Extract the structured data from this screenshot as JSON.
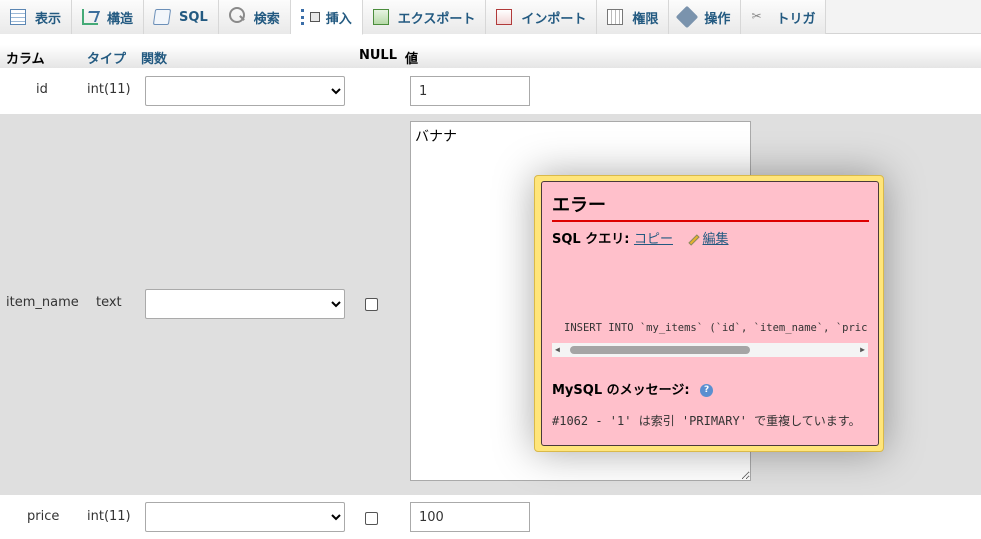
{
  "tabs": [
    {
      "label": "表示",
      "icon": "table-icon"
    },
    {
      "label": "構造",
      "icon": "structure-icon"
    },
    {
      "label": "SQL",
      "icon": "sql-icon"
    },
    {
      "label": "検索",
      "icon": "search-icon"
    },
    {
      "label": "挿入",
      "icon": "insert-icon",
      "active": true
    },
    {
      "label": "エクスポート",
      "icon": "export-icon"
    },
    {
      "label": "インポート",
      "icon": "import-icon"
    },
    {
      "label": "権限",
      "icon": "privileges-icon"
    },
    {
      "label": "操作",
      "icon": "wrench-icon"
    },
    {
      "label": "トリガ",
      "icon": "trigger-icon"
    }
  ],
  "header": {
    "column": "カラム",
    "type": "タイプ",
    "function": "関数",
    "null": "NULL",
    "value": "値"
  },
  "rows": [
    {
      "name": "id",
      "type": "int(11)",
      "value": "1"
    },
    {
      "name": "item_name",
      "type": "text",
      "value": "バナナ"
    },
    {
      "name": "price",
      "type": "int(11)",
      "value": "100"
    }
  ],
  "error": {
    "title": "エラー",
    "sql_label": "SQL クエリ:",
    "copy_link": "コピー",
    "edit_link": "編集",
    "query": "INSERT INTO `my_items` (`id`, `item_name`, `price`) V",
    "mysql_label": "MySQL のメッセージ:",
    "message": "#1062 - '1' は索引 'PRIMARY' で重複しています。"
  },
  "colors": {
    "accent": "#235a81",
    "popup_bg": "#ffc0cb",
    "popup_border": "#ffe57a",
    "error_rule": "#dd0000"
  }
}
